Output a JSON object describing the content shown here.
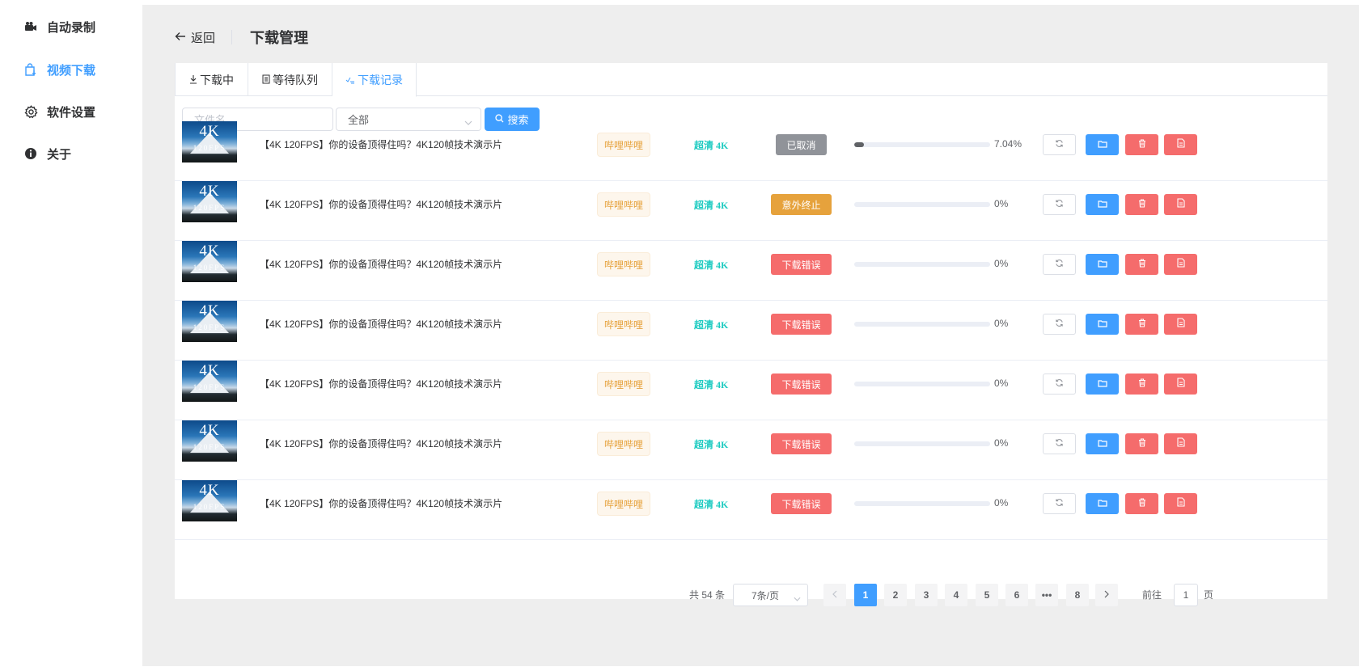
{
  "colors": {
    "primary": "#409eff",
    "danger": "#f56c6c",
    "warning": "#e6a23c",
    "info": "#909399",
    "quality": "#1ecbc1"
  },
  "sidebar": {
    "items": [
      {
        "label": "自动录制",
        "icon": "camera-icon",
        "active": false
      },
      {
        "label": "视频下载",
        "icon": "download-bag-icon",
        "active": true
      },
      {
        "label": "软件设置",
        "icon": "gear-icon",
        "active": false
      },
      {
        "label": "关于",
        "icon": "info-icon",
        "active": false
      }
    ]
  },
  "header": {
    "back_label": "返回",
    "title": "下载管理"
  },
  "tabs": [
    {
      "label": "下载中",
      "icon": "download-arrow-icon",
      "active": false
    },
    {
      "label": "等待队列",
      "icon": "list-icon",
      "active": false
    },
    {
      "label": "下载记录",
      "icon": "check-list-icon",
      "active": true
    }
  ],
  "search": {
    "filename_placeholder": "文件名",
    "filter_value": "全部",
    "search_label": "搜索"
  },
  "row_actions": {
    "retry_icon": "refresh-icon",
    "folder_icon": "folder-icon",
    "delete_icon": "trash-icon",
    "file_icon": "file-icon"
  },
  "rows": [
    {
      "thumb_big": "4K",
      "thumb_small": "120FPS",
      "title": "【4K 120FPS】你的设备顶得住吗？4K120帧技术演示片",
      "site": "哔哩哔哩",
      "quality": "超清 4K",
      "status": "已取消",
      "status_type": "info",
      "progress": 7.04,
      "progress_label": "7.04%"
    },
    {
      "thumb_big": "4K",
      "thumb_small": "120FPS",
      "title": "【4K 120FPS】你的设备顶得住吗？4K120帧技术演示片",
      "site": "哔哩哔哩",
      "quality": "超清 4K",
      "status": "意外终止",
      "status_type": "warning",
      "progress": 0,
      "progress_label": "0%"
    },
    {
      "thumb_big": "4K",
      "thumb_small": "120FPS",
      "title": "【4K 120FPS】你的设备顶得住吗？4K120帧技术演示片",
      "site": "哔哩哔哩",
      "quality": "超清 4K",
      "status": "下载错误",
      "status_type": "danger",
      "progress": 0,
      "progress_label": "0%"
    },
    {
      "thumb_big": "4K",
      "thumb_small": "120FPS",
      "title": "【4K 120FPS】你的设备顶得住吗？4K120帧技术演示片",
      "site": "哔哩哔哩",
      "quality": "超清 4K",
      "status": "下载错误",
      "status_type": "danger",
      "progress": 0,
      "progress_label": "0%"
    },
    {
      "thumb_big": "4K",
      "thumb_small": "120FPS",
      "title": "【4K 120FPS】你的设备顶得住吗？4K120帧技术演示片",
      "site": "哔哩哔哩",
      "quality": "超清 4K",
      "status": "下载错误",
      "status_type": "danger",
      "progress": 0,
      "progress_label": "0%"
    },
    {
      "thumb_big": "4K",
      "thumb_small": "120FPS",
      "title": "【4K 120FPS】你的设备顶得住吗？4K120帧技术演示片",
      "site": "哔哩哔哩",
      "quality": "超清 4K",
      "status": "下载错误",
      "status_type": "danger",
      "progress": 0,
      "progress_label": "0%"
    },
    {
      "thumb_big": "4K",
      "thumb_small": "120FPS",
      "title": "【4K 120FPS】你的设备顶得住吗？4K120帧技术演示片",
      "site": "哔哩哔哩",
      "quality": "超清 4K",
      "status": "下载错误",
      "status_type": "danger",
      "progress": 0,
      "progress_label": "0%"
    }
  ],
  "pagination": {
    "total_label": "共 54 条",
    "page_size_label": "7条/页",
    "pages": [
      "1",
      "2",
      "3",
      "4",
      "5",
      "6",
      "•••",
      "8"
    ],
    "current_page": "1",
    "goto_label": "前往",
    "goto_value": "1",
    "page_suffix": "页",
    "prev_icon": "chevron-left-icon",
    "next_icon": "chevron-right-icon"
  }
}
